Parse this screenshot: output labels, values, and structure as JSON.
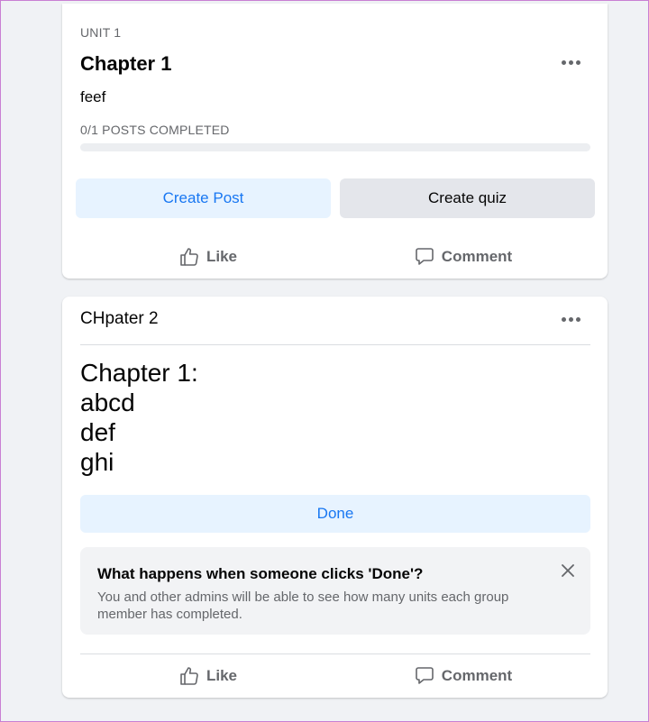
{
  "unit_card": {
    "unit_label": "UNIT 1",
    "title": "Chapter 1",
    "description": "feef",
    "progress_text": "0/1 POSTS COMPLETED",
    "progress_fraction": 0,
    "create_post_label": "Create Post",
    "create_quiz_label": "Create quiz",
    "like_label": "Like",
    "comment_label": "Comment"
  },
  "post_card": {
    "author": "CHpater 2",
    "body_lines": [
      "Chapter 1:",
      "abcd",
      "def",
      "ghi"
    ],
    "done_label": "Done",
    "info": {
      "title": "What happens when someone clicks 'Done'?",
      "text": "You and other admins will be able to see how many units each group member has completed."
    },
    "like_label": "Like",
    "comment_label": "Comment"
  },
  "colors": {
    "accent": "#1877f2",
    "accent_bg": "#e7f3ff",
    "secondary_bg": "#e4e6eb",
    "page_bg": "#f0f2f5"
  },
  "icons": [
    "more-icon",
    "like-icon",
    "comment-icon",
    "close-icon"
  ]
}
